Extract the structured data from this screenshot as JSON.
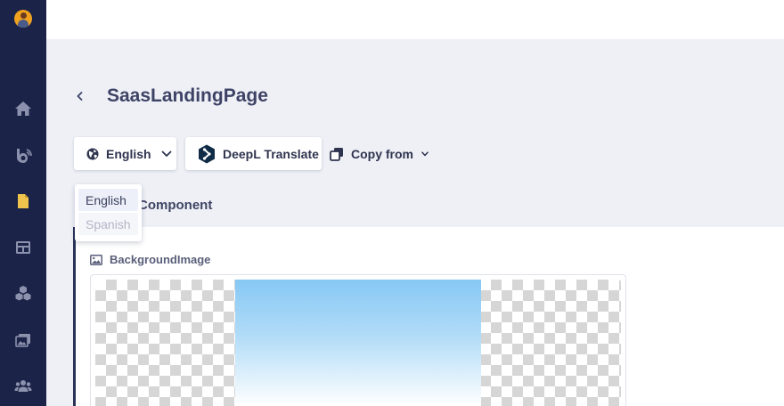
{
  "sidebar": {
    "items": [
      {
        "icon": "home-icon"
      },
      {
        "icon": "blog-icon"
      },
      {
        "icon": "document-icon",
        "active": true
      },
      {
        "icon": "layout-icon"
      },
      {
        "icon": "cubes-icon"
      },
      {
        "icon": "media-icon"
      },
      {
        "icon": "users-icon"
      }
    ]
  },
  "page": {
    "title": "SaasLandingPage"
  },
  "toolbar": {
    "language_label": "English",
    "deepl_label": "DeepL Translate",
    "copy_from_label": "Copy from"
  },
  "language_dropdown": {
    "options": [
      "English",
      "Spanish"
    ],
    "selected": "English"
  },
  "section": {
    "title_visible": "Component"
  },
  "field": {
    "label": "BackgroundImage"
  },
  "colors": {
    "sidebar_bg": "#1b2348",
    "page_bg": "#eef0f6",
    "accent_active_icon": "#f0c44c",
    "title_text": "#3e4366"
  }
}
